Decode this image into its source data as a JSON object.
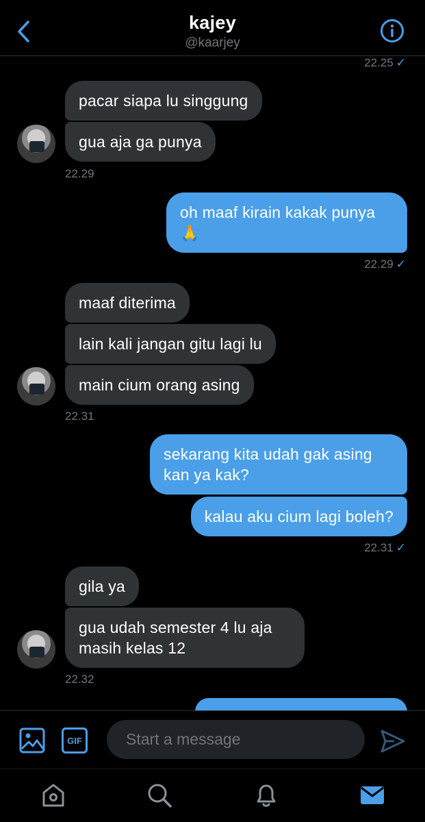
{
  "header": {
    "title": "kajey",
    "handle": "@kaarjey"
  },
  "messages": [
    {
      "time": "22.25"
    },
    {
      "text": "pacar siapa lu singgung"
    },
    {
      "text": "gua aja ga punya"
    },
    {
      "time": "22.29"
    },
    {
      "text": "oh maaf kirain kakak punya",
      "emoji": "🙏"
    },
    {
      "time": "22.29"
    },
    {
      "text": "maaf diterima"
    },
    {
      "text": "lain kali jangan gitu lagi lu"
    },
    {
      "text": "main cium orang asing"
    },
    {
      "time": "22.31"
    },
    {
      "text": "sekarang kita udah gak asing kan ya kak?"
    },
    {
      "text": "kalau aku cium lagi boleh?"
    },
    {
      "time": "22.31"
    },
    {
      "text": "gila ya"
    },
    {
      "text": "gua udah semester 4 lu aja masih kelas 12"
    },
    {
      "time": "22.32"
    }
  ],
  "composer": {
    "placeholder": "Start a message",
    "gif_label": "GIF"
  },
  "colors": {
    "accent": "#4a9fe8",
    "incoming_bubble": "#2f3336",
    "background": "#000000"
  },
  "icons": {
    "back": "chevron-left-icon",
    "info": "info-icon",
    "image": "image-icon",
    "send": "send-icon"
  }
}
